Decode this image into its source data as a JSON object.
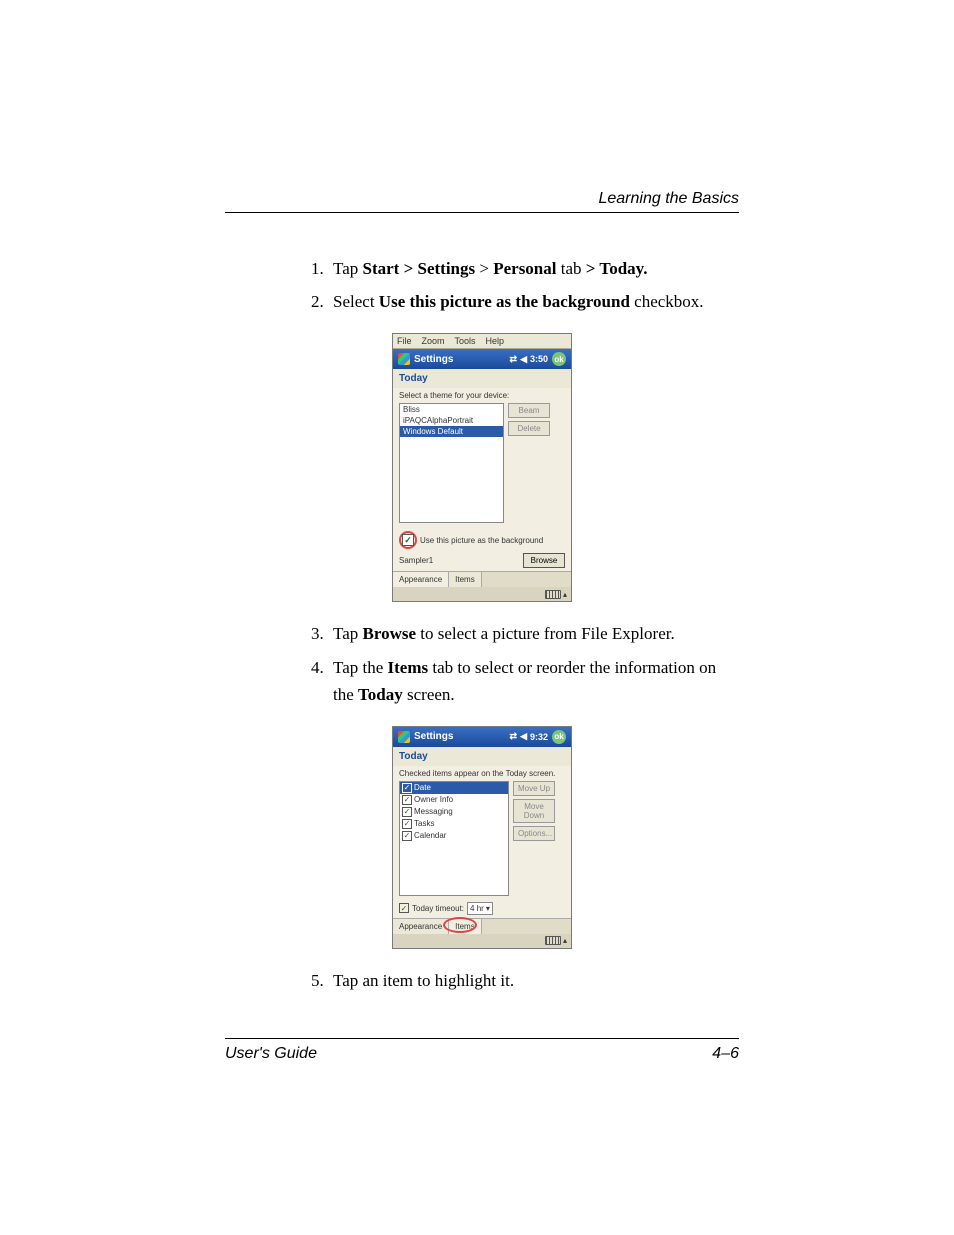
{
  "header": {
    "section_title": "Learning the Basics"
  },
  "steps": {
    "s1": {
      "num": "1.",
      "pre": "Tap ",
      "b1": "Start > Settings",
      "mid1": " > ",
      "b2": "Personal",
      "mid2": " tab ",
      "b3": "> Today."
    },
    "s2": {
      "num": "2.",
      "pre": "Select ",
      "b1": "Use this picture as the background",
      "post": " checkbox."
    },
    "s3": {
      "num": "3.",
      "pre": "Tap ",
      "b1": "Browse",
      "post": " to select a picture from File Explorer."
    },
    "s4": {
      "num": "4.",
      "pre": "Tap the ",
      "b1": "Items",
      "mid1": " tab to select or reorder the information on the ",
      "b2": "Today",
      "post": " screen."
    },
    "s5": {
      "num": "5.",
      "text": "Tap an item to highlight it."
    }
  },
  "ppc1": {
    "menu": {
      "file": "File",
      "zoom": "Zoom",
      "tools": "Tools",
      "help": "Help"
    },
    "title": "Settings",
    "time": "3:50",
    "ok": "ok",
    "subhead": "Today",
    "instr": "Select a theme for your device:",
    "themes": {
      "t0": "Bliss",
      "t1": "iPAQCAlphaPortrait",
      "t2": "Windows Default"
    },
    "btn_beam": "Beam",
    "btn_delete": "Delete",
    "use_bg": "Use this picture as the background",
    "sample": "Sampler1",
    "btn_browse": "Browse",
    "tab_appearance": "Appearance",
    "tab_items": "Items"
  },
  "ppc2": {
    "title": "Settings",
    "time": "9:32",
    "ok": "ok",
    "subhead": "Today",
    "instr": "Checked items appear on the Today screen.",
    "items": {
      "i0": "Date",
      "i1": "Owner Info",
      "i2": "Messaging",
      "i3": "Tasks",
      "i4": "Calendar"
    },
    "btn_moveup": "Move Up",
    "btn_movedown": "Move Down",
    "btn_options": "Options...",
    "timeout_label": "Today timeout:",
    "timeout_value": "4 hr",
    "tab_appearance": "Appearance",
    "tab_items": "Items"
  },
  "footer": {
    "left": "User's Guide",
    "right": "4–6"
  }
}
